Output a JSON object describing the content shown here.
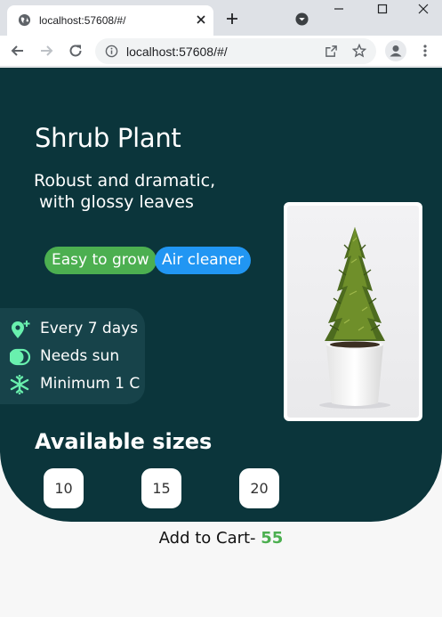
{
  "browser": {
    "tab_title": "localhost:57608/#/",
    "url": "localhost:57608/#/"
  },
  "plant": {
    "title": "Shrub Plant",
    "description": "Robust and dramatic,\n with glossy leaves",
    "tags": [
      {
        "label": "Easy to grow",
        "color": "#4caf50"
      },
      {
        "label": "Air cleaner",
        "color": "#2196f3"
      }
    ],
    "care": [
      {
        "icon": "watering-pin-icon",
        "text": "Every 7 days"
      },
      {
        "icon": "toggle-sun-icon",
        "text": "Needs sun"
      },
      {
        "icon": "snowflake-icon",
        "text": "Minimum 1 C"
      }
    ],
    "sizes_label": "Available sizes",
    "sizes": [
      "10",
      "15",
      "20"
    ]
  },
  "cart": {
    "label": "Add to Cart- ",
    "price": "55"
  },
  "colors": {
    "hero_bg": "#0b353b",
    "accent_green": "#4caf50",
    "accent_blue": "#2196f3",
    "care_icon": "#69f0ae"
  }
}
